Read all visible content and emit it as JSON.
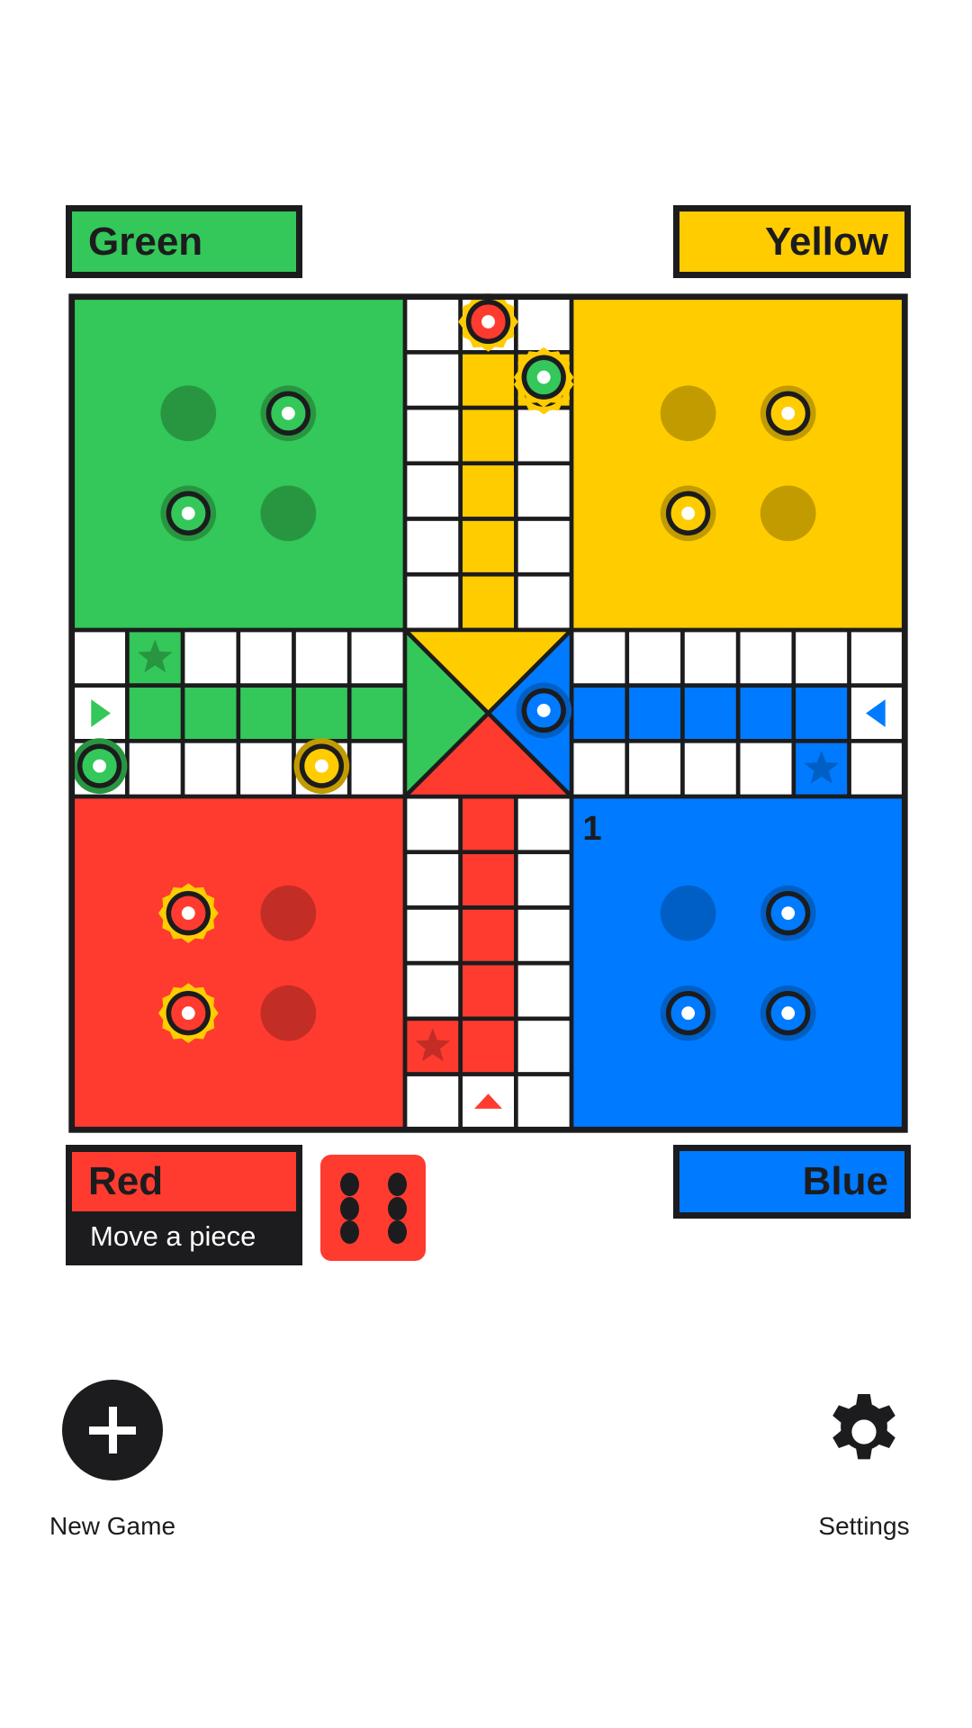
{
  "players": {
    "green": {
      "label": "Green"
    },
    "yellow": {
      "label": "Yellow"
    },
    "red": {
      "label": "Red",
      "status": "Move a piece"
    },
    "blue": {
      "label": "Blue"
    }
  },
  "current_player": "red",
  "dice": {
    "value": 6
  },
  "colors": {
    "green": "#34c759",
    "green_dark": "#289640",
    "yellow": "#ffcc00",
    "yellow_dark": "#c29b00",
    "red": "#ff3b30",
    "red_dark": "#c22d25",
    "blue": "#007aff",
    "blue_dark": "#005fc4",
    "line": "#1c1c1e",
    "highlight": "#ffcc00"
  },
  "board": {
    "blue_home_count": "1",
    "home_slots": {
      "green": [
        {
          "slot": 0,
          "occupied": false
        },
        {
          "slot": 1,
          "occupied": true
        },
        {
          "slot": 2,
          "occupied": true
        },
        {
          "slot": 3,
          "occupied": false
        }
      ],
      "yellow": [
        {
          "slot": 0,
          "occupied": false
        },
        {
          "slot": 1,
          "occupied": true
        },
        {
          "slot": 2,
          "occupied": true
        },
        {
          "slot": 3,
          "occupied": false
        }
      ],
      "red": [
        {
          "slot": 0,
          "occupied": true,
          "movable": true
        },
        {
          "slot": 1,
          "occupied": false
        },
        {
          "slot": 2,
          "occupied": true,
          "movable": true
        },
        {
          "slot": 3,
          "occupied": false
        }
      ],
      "blue": [
        {
          "slot": 0,
          "occupied": false
        },
        {
          "slot": 1,
          "occupied": true
        },
        {
          "slot": 2,
          "occupied": true
        },
        {
          "slot": 3,
          "occupied": true
        }
      ]
    },
    "track_pieces": [
      {
        "color": "red",
        "col": 7,
        "row": 0,
        "movable": true
      },
      {
        "color": "green",
        "col": 8,
        "row": 1,
        "movable": true,
        "stacked_on": "red"
      },
      {
        "color": "green",
        "col": 0,
        "row": 8
      },
      {
        "color": "yellow",
        "col": 4,
        "row": 8
      },
      {
        "color": "blue",
        "col": 8,
        "row": 7
      }
    ]
  },
  "actions": {
    "new_game": {
      "label": "New Game",
      "icon": "plus-icon"
    },
    "settings": {
      "label": "Settings",
      "icon": "gear-icon"
    }
  }
}
